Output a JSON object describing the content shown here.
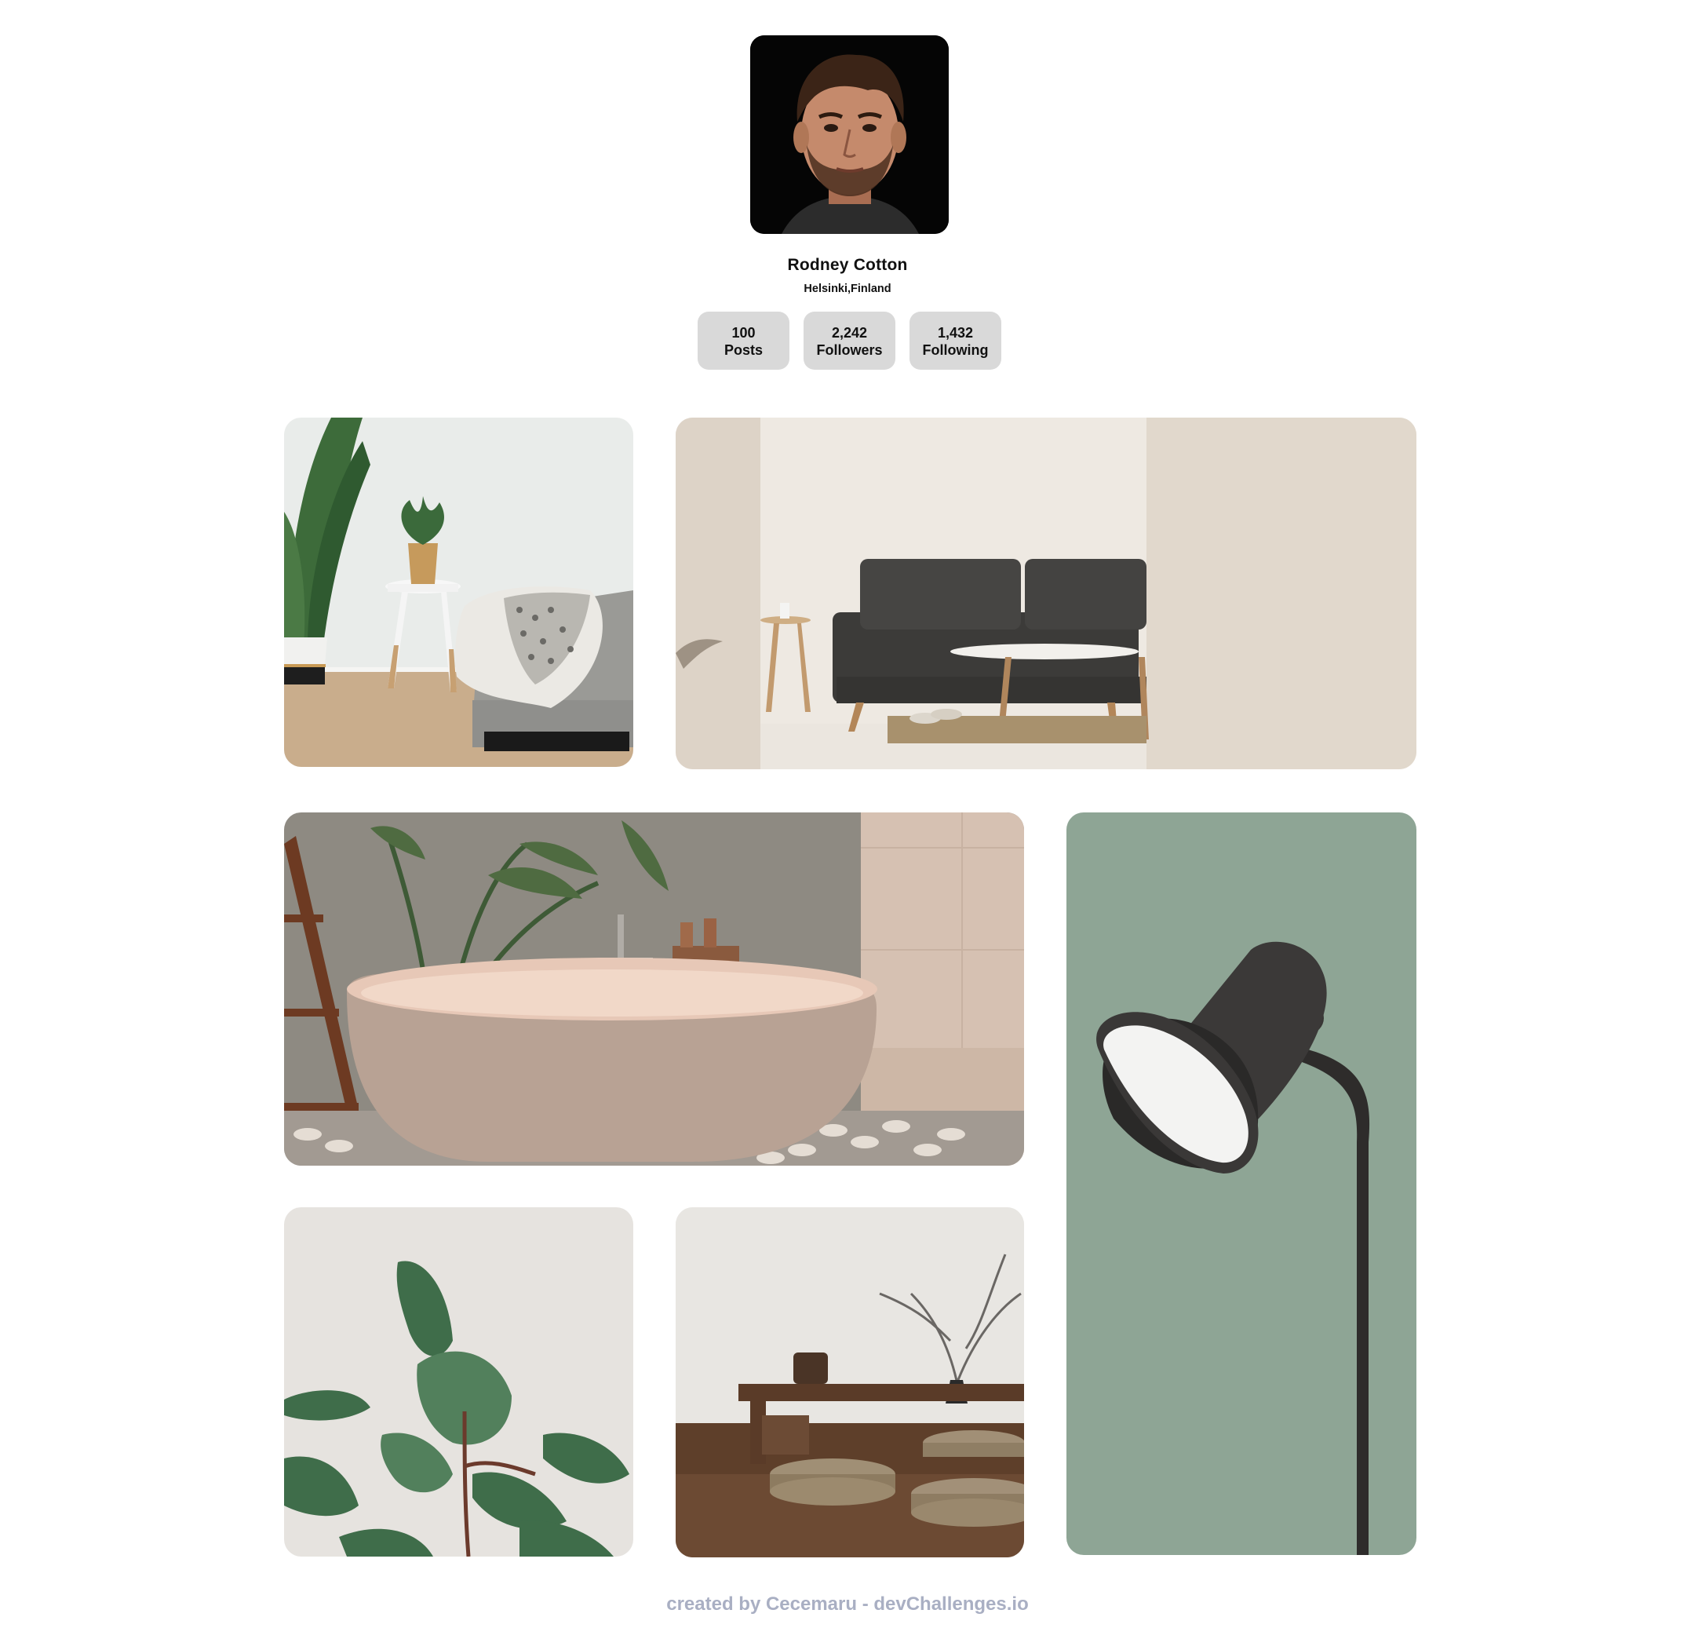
{
  "profile": {
    "name": "Rodney Cotton",
    "location": "Helsinki,Finland",
    "stats": [
      {
        "value": "100",
        "label": "Posts"
      },
      {
        "value": "2,242",
        "label": "Followers"
      },
      {
        "value": "1,432",
        "label": "Following"
      }
    ]
  },
  "gallery": {
    "tiles": [
      {
        "subject": "bedroom with side table and potted plant"
      },
      {
        "subject": "living room with dark sofa and coffee table"
      },
      {
        "subject": "freestanding bathtub with plants"
      },
      {
        "subject": "dark floor lamp on green wall"
      },
      {
        "subject": "rubber plant leaves"
      },
      {
        "subject": "low wooden table with floor cushions"
      }
    ]
  },
  "footer": {
    "text": "created by Cecemaru - devChallenges.io"
  },
  "colors": {
    "stat_bg": "#d9d9d9",
    "footer_text": "#a9afc3",
    "background": "#ffffff"
  }
}
